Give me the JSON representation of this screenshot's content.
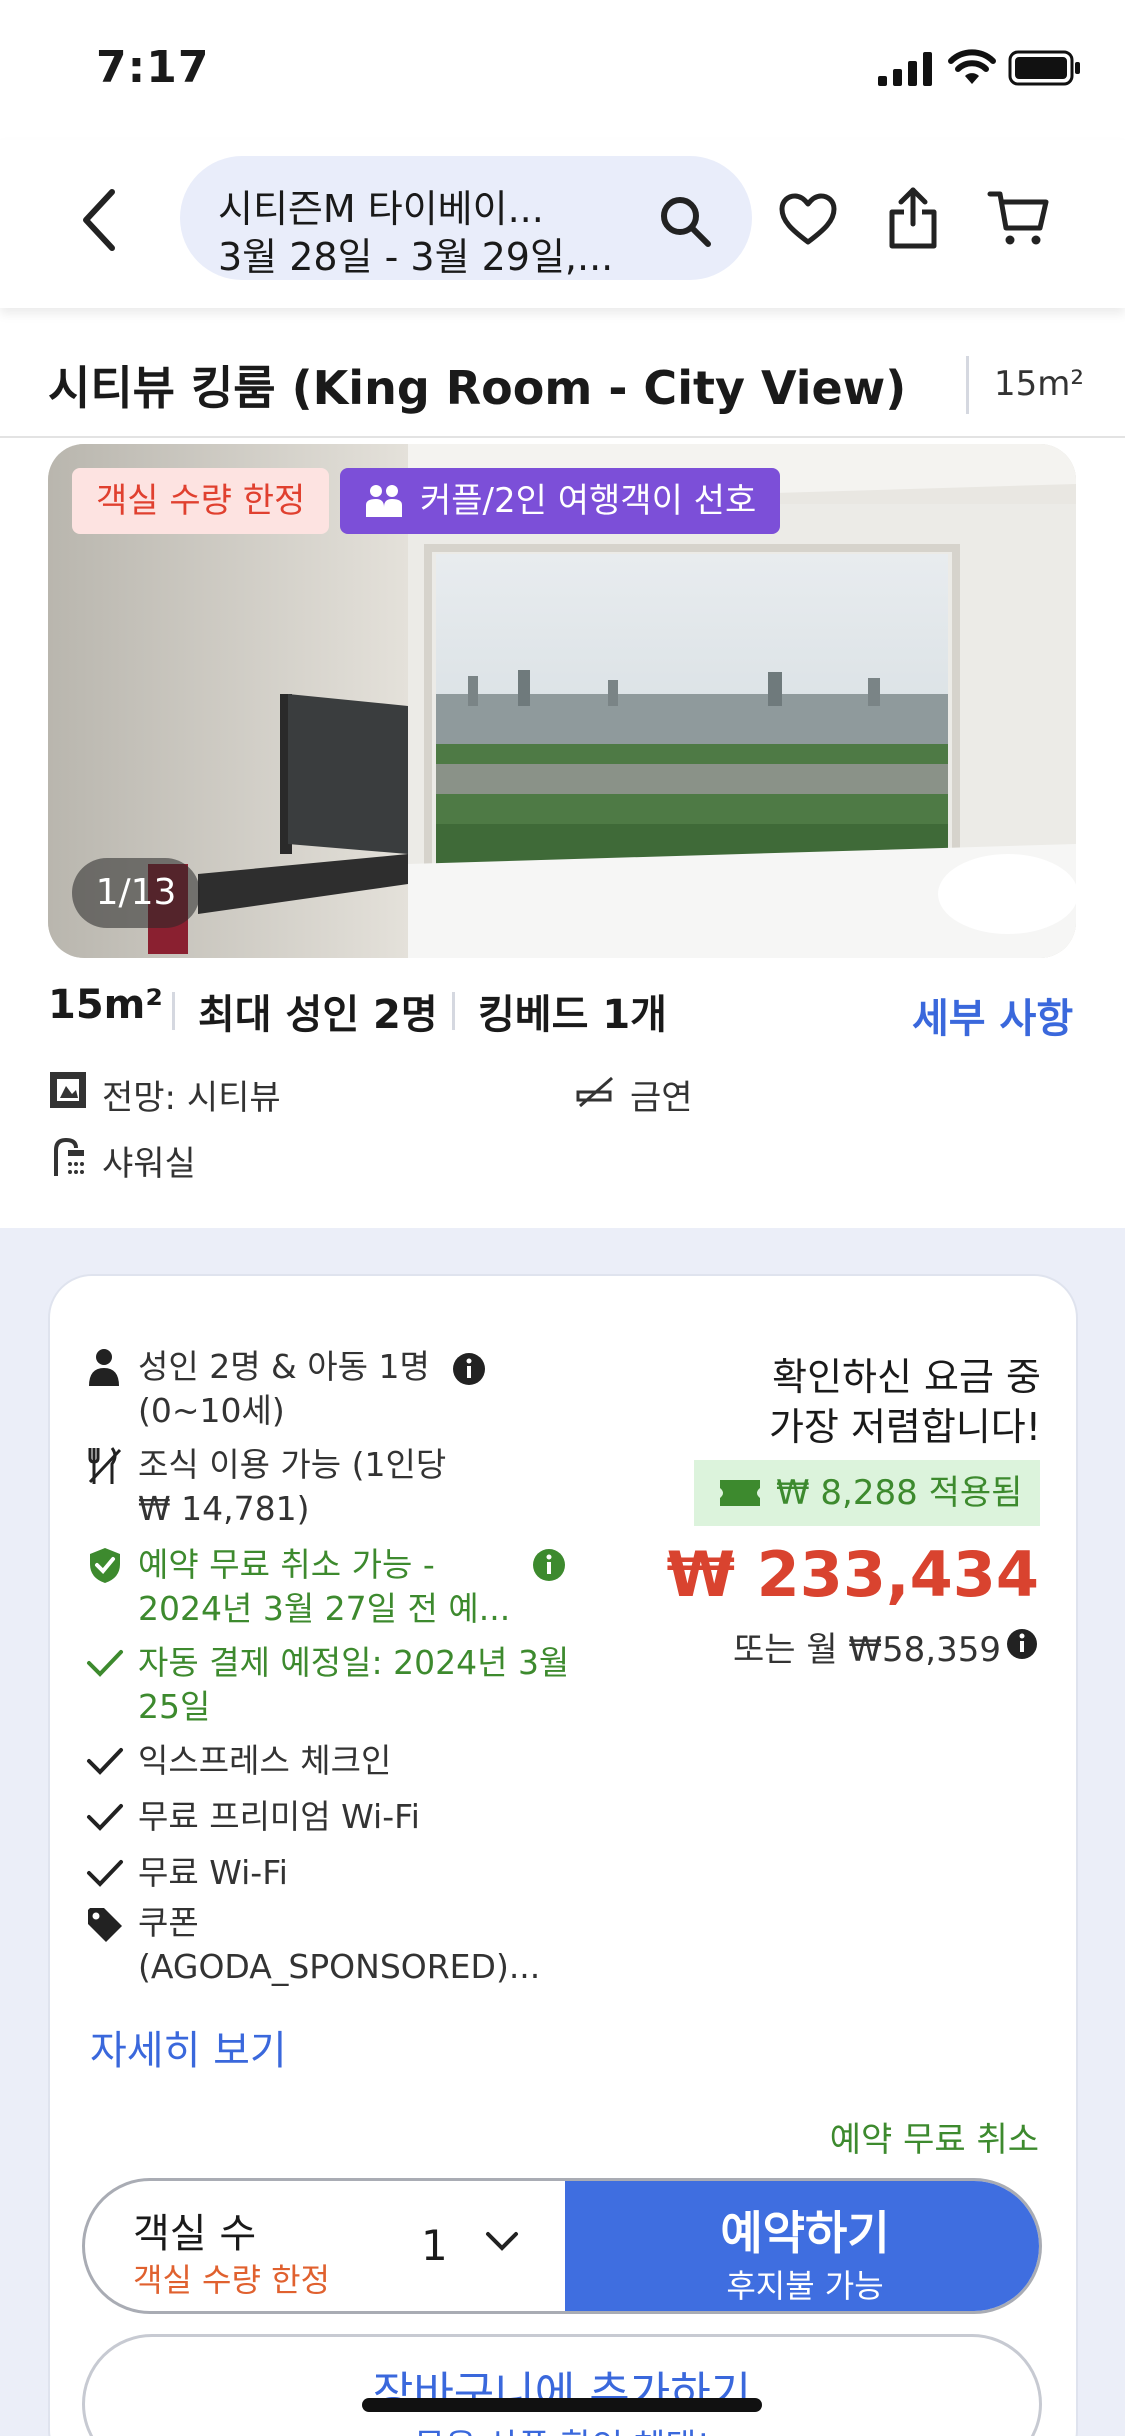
{
  "status_bar": {
    "time": "7:17"
  },
  "header": {
    "search_title": "시티즌M 타이베이...",
    "search_dates": "3월 28일 - 3월 29일,...",
    "icons": [
      "back-icon",
      "search-icon",
      "heart-icon",
      "share-icon",
      "cart-icon"
    ]
  },
  "room": {
    "title": "시티뷰 킹룸 (King Room - City View)",
    "size": "15m²"
  },
  "photo": {
    "badge_limited": "객실 수량 한정",
    "badge_couple": "커플/2인 여행객이 선호",
    "counter": "1/13"
  },
  "specs": {
    "size": "15m²",
    "capacity": "최대 성인 2명",
    "bed": "킹베드 1개",
    "details_link": "세부 사항"
  },
  "features": {
    "view": "전망: 시티뷰",
    "smoking": "금연",
    "shower": "샤워실"
  },
  "offer": {
    "guests_line1": "성인 2명 & 아동 1명",
    "guests_line2": "(0~10세)",
    "breakfast_line1": "조식 이용 가능 (1인당",
    "breakfast_line2": "₩ 14,781)",
    "cancel_line1": "예약 무료 취소 가능 -",
    "cancel_line2": "2024년 3월 27일 전 예...",
    "autopay_line1": "자동 결제 예정일: 2024년 3월",
    "autopay_line2": "25일",
    "express": "익스프레스 체크인",
    "premium_wifi": "무료 프리미엄 Wi-Fi",
    "wifi": "무료 Wi-Fi",
    "coupon_line1": "쿠폰",
    "coupon_line2": "(AGODA_SPONSORED)...",
    "more_link": "자세히 보기",
    "best_line1": "확인하신 요금 중",
    "best_line2": "가장 저렴합니다!",
    "coupon_applied": "₩ 8,288 적용됨",
    "price": "₩ 233,434",
    "monthly": "또는 월 ₩58,359",
    "free_cancel": "예약 무료 취소",
    "rooms_label": "객실 수",
    "rooms_limited": "객실 수량 한정",
    "quantity": "1",
    "book_label": "예약하기",
    "book_sub": "후지불 가능",
    "cart_label": "장바구니에 추가하기",
    "cart_sub": "묶음 상품 할인 혜택!"
  },
  "colors": {
    "accent_blue": "#3f6ee0",
    "price_red": "#d9432f",
    "green": "#3d8a2e",
    "purple_badge": "#7c4fd8"
  }
}
